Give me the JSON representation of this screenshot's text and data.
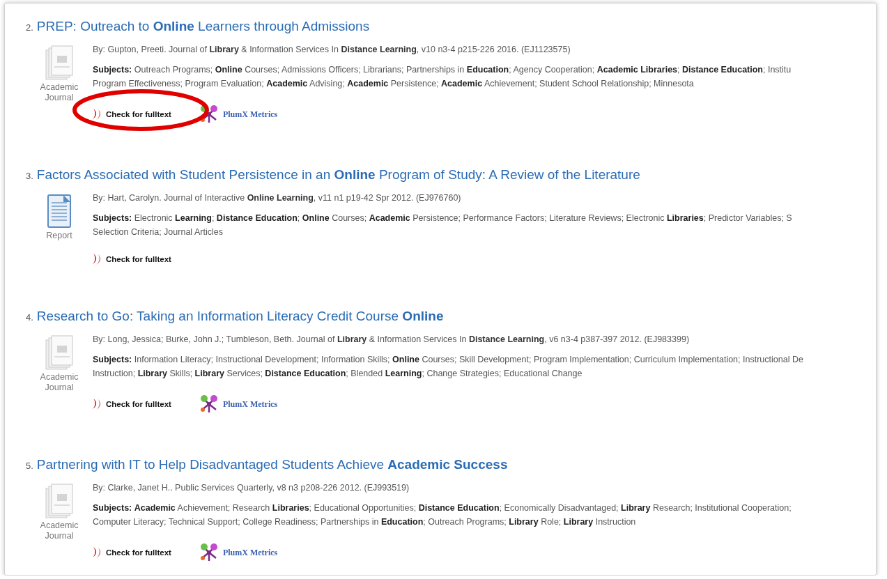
{
  "results": [
    {
      "number": "2.",
      "title": "PREP: Outreach to **Online** Learners through Admissions",
      "type": {
        "kind": "journal",
        "label": "Academic Journal"
      },
      "meta": "By: Gupton, Preeti. Journal of **Library** & Information Services In **Distance Learning**, v10 n3-4 p215-226 2016. (EJ1123575)",
      "subject_lines": [
        "**Subjects:** Outreach Programs; **Online** Courses; Admissions Officers; Librarians; Partnerships in **Education**; Agency Cooperation; **Academic Libraries**; **Distance Education**; Institu",
        "Program Effectiveness; Program Evaluation; **Academic** Advising; **Academic** Persistence; **Academic** Achievement; Student School Relationship; Minnesota"
      ],
      "fulltext": {
        "label": "Check for fulltext",
        "circled": true
      },
      "plumx": "PlumX Metrics"
    },
    {
      "number": "3.",
      "title": "Factors Associated with Student Persistence in an **Online** Program of Study: A Review of the Literature",
      "type": {
        "kind": "report",
        "label": "Report"
      },
      "meta": "By: Hart, Carolyn. Journal of Interactive **Online Learning**, v11 n1 p19-42 Spr 2012. (EJ976760)",
      "subject_lines": [
        "**Subjects:** Electronic **Learning**; **Distance Education**; **Online** Courses; **Academic** Persistence; Performance Factors; Literature Reviews; Electronic **Libraries**; Predictor Variables; S",
        "Selection Criteria; Journal Articles"
      ],
      "fulltext": {
        "label": "Check for fulltext",
        "circled": false
      }
    },
    {
      "number": "4.",
      "title": "Research to Go: Taking an Information Literacy Credit Course **Online**",
      "type": {
        "kind": "journal",
        "label": "Academic Journal"
      },
      "meta": "By: Long, Jessica; Burke, John J.; Tumbleson, Beth. Journal of **Library** & Information Services In **Distance Learning**, v6 n3-4 p387-397 2012. (EJ983399)",
      "subject_lines": [
        "**Subjects:** Information Literacy; Instructional Development; Information Skills; **Online** Courses; Skill Development; Program Implementation; Curriculum Implementation; Instructional De",
        "Instruction; **Library** Skills; **Library** Services; **Distance Education**; Blended **Learning**; Change Strategies; Educational Change"
      ],
      "fulltext": {
        "label": "Check for fulltext",
        "circled": false
      },
      "plumx": "PlumX Metrics"
    },
    {
      "number": "5.",
      "title": "Partnering with IT to Help Disadvantaged Students Achieve **Academic Success**",
      "type": {
        "kind": "journal",
        "label": "Academic Journal"
      },
      "meta": "By: Clarke, Janet H.. Public Services Quarterly, v8 n3 p208-226 2012. (EJ993519)",
      "subject_lines": [
        "**Subjects:** **Academic** Achievement; Research **Libraries**; Educational Opportunities; **Distance Education**; Economically Disadvantaged; **Library** Research; Institutional Cooperation;",
        "Computer Literacy; Technical Support; College Readiness; Partnerships in **Education**; Outreach Programs; **Library** Role; **Library** Instruction"
      ],
      "fulltext": {
        "label": "Check for fulltext",
        "circled": false
      },
      "plumx": "PlumX Metrics"
    }
  ]
}
